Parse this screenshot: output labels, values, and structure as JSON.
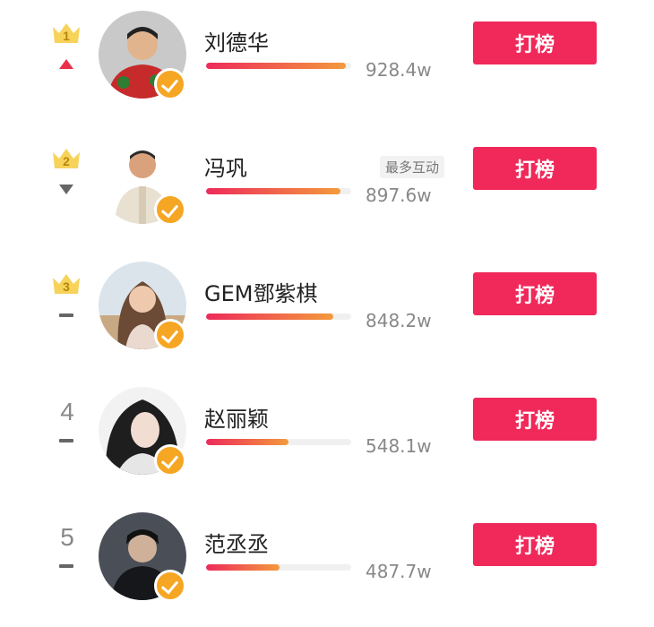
{
  "leaderboard": {
    "items": [
      {
        "rank": "1",
        "trend": "up",
        "name": "刘德华",
        "votes": "928.4w",
        "score": 928.4,
        "tag": "",
        "button": "打榜",
        "avatar": "portrait-man-red-shirt"
      },
      {
        "rank": "2",
        "trend": "down",
        "name": "冯巩",
        "votes": "897.6w",
        "score": 897.6,
        "tag": "最多互动",
        "button": "打榜",
        "avatar": "portrait-man-white-jacket"
      },
      {
        "rank": "3",
        "trend": "same",
        "name": "GEM鄧紫棋",
        "votes": "848.2w",
        "score": 848.2,
        "tag": "",
        "button": "打榜",
        "avatar": "portrait-woman-desert"
      },
      {
        "rank": "4",
        "trend": "same",
        "name": "赵丽颖",
        "votes": "548.1w",
        "score": 548.1,
        "tag": "",
        "button": "打榜",
        "avatar": "portrait-woman-black-white"
      },
      {
        "rank": "5",
        "trend": "same",
        "name": "范丞丞",
        "votes": "487.7w",
        "score": 487.7,
        "tag": "",
        "button": "打榜",
        "avatar": "portrait-man-dark"
      }
    ]
  },
  "colors": {
    "button": "#f0295a",
    "bar_start": "#ee2a5a",
    "bar_end": "#f39a3c",
    "crown": "#f7d35a",
    "verified": "#f5a623",
    "trend_up": "#e8304a"
  }
}
